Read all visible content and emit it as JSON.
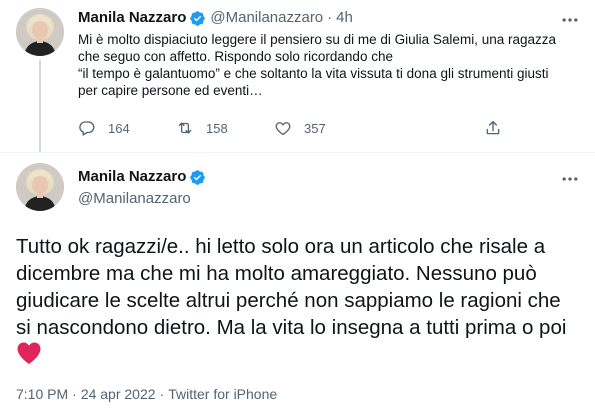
{
  "colors": {
    "verified": "#1d9bf0",
    "text": "#0f1419",
    "secondary": "#536471",
    "heart": "#e0245e"
  },
  "tweet_reply": {
    "author_name": "Manila Nazzaro",
    "handle": "@Manilanazzaro",
    "separator": "·",
    "time": "4h",
    "text": "Mi è molto dispiaciuto leggere il pensiero su di me di Giulia Salemi, una ragazza che seguo con affetto. Rispondo solo ricordando che \n“il tempo è galantuomo” e che soltanto la vita vissuta ti dona gli strumenti giusti per capire persone ed eventi…",
    "reply_count": "164",
    "retweet_count": "158",
    "like_count": "357",
    "icons": [
      "verified-badge-icon",
      "more-icon",
      "reply-icon",
      "retweet-icon",
      "like-icon",
      "share-icon"
    ]
  },
  "tweet_main": {
    "author_name": "Manila Nazzaro",
    "handle": "@Manilanazzaro",
    "text": "Tutto ok ragazzi/e.. hi letto solo ora un articolo che risale a dicembre ma che mi ha molto amareggiato. Nessuno può giudicare le scelte altrui perché non sappiamo le ragioni che si nascondono dietro. Ma la vita lo insegna a tutti prima o poi ",
    "emoji": "red-heart-icon",
    "time": "7:10 PM",
    "date": "24 apr 2022",
    "source": "Twitter for iPhone",
    "dot": "·"
  }
}
